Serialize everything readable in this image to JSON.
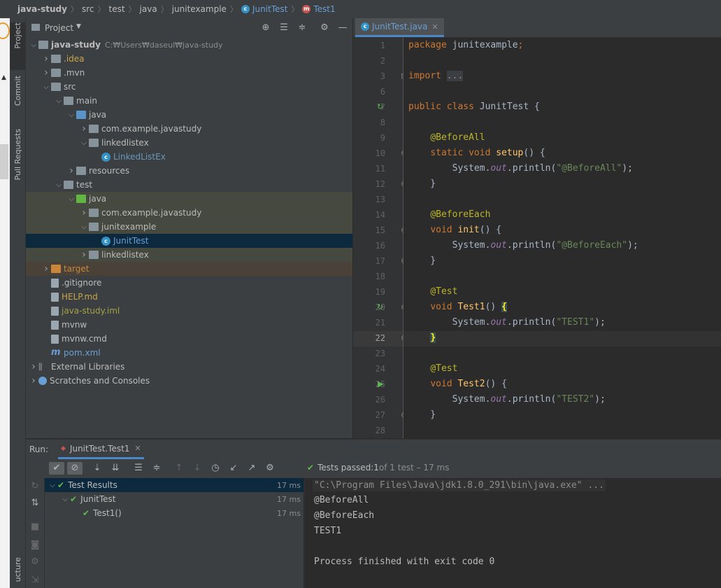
{
  "breadcrumb": [
    {
      "label": "java-study",
      "icon": "",
      "bold": true
    },
    {
      "label": "src",
      "icon": ""
    },
    {
      "label": "test",
      "icon": ""
    },
    {
      "label": "java",
      "icon": ""
    },
    {
      "label": "junitexample",
      "icon": ""
    },
    {
      "label": "JunitTest",
      "icon": "class-icon"
    },
    {
      "label": "Test1",
      "icon": "method-icon"
    }
  ],
  "left_strip": {
    "project": "Project",
    "commit": "Commit",
    "pull_requests": "Pull Requests",
    "structure": "ucture"
  },
  "project_panel": {
    "title": "Project",
    "tree": [
      {
        "label": "java-study",
        "suffix": "C:₩Users₩daseul₩java-study",
        "depth": 0,
        "arrow": "open",
        "icon": "folder",
        "color": "#bbbbbb",
        "bold": true
      },
      {
        "label": ".idea",
        "depth": 1,
        "arrow": "closed",
        "icon": "folder",
        "color": "#c9a64a"
      },
      {
        "label": ".mvn",
        "depth": 1,
        "arrow": "closed",
        "icon": "folder",
        "color": "#bbbbbb"
      },
      {
        "label": "src",
        "depth": 1,
        "arrow": "open",
        "icon": "folder",
        "color": "#bbbbbb"
      },
      {
        "label": "main",
        "depth": 2,
        "arrow": "open",
        "icon": "folder",
        "color": "#bbbbbb"
      },
      {
        "label": "java",
        "depth": 3,
        "arrow": "open",
        "icon": "folder-blue",
        "color": "#bbbbbb"
      },
      {
        "label": "com.example.javastudy",
        "depth": 4,
        "arrow": "closed",
        "icon": "folder",
        "color": "#bbbbbb"
      },
      {
        "label": "linkedlistex",
        "depth": 4,
        "arrow": "open",
        "icon": "folder",
        "color": "#bbbbbb"
      },
      {
        "label": "LinkedListEx",
        "depth": 5,
        "arrow": "",
        "icon": "cls",
        "color": "#6897bb"
      },
      {
        "label": "resources",
        "depth": 3,
        "arrow": "closed",
        "icon": "folder",
        "color": "#bbbbbb"
      },
      {
        "label": "test",
        "depth": 2,
        "arrow": "open",
        "icon": "folder",
        "color": "#bbbbbb"
      },
      {
        "label": "java",
        "depth": 3,
        "arrow": "open",
        "icon": "folder-green",
        "color": "#bbbbbb",
        "bg": "#45493f"
      },
      {
        "label": "com.example.javastudy",
        "depth": 4,
        "arrow": "closed",
        "icon": "folder",
        "color": "#bbbbbb",
        "bg": "#45493f"
      },
      {
        "label": "junitexample",
        "depth": 4,
        "arrow": "open",
        "icon": "folder",
        "color": "#bbbbbb",
        "bg": "#45493f"
      },
      {
        "label": "JunitTest",
        "depth": 5,
        "arrow": "",
        "icon": "cls",
        "color": "#6a9fd6",
        "bg": "#0d293e"
      },
      {
        "label": "linkedlistex",
        "depth": 4,
        "arrow": "closed",
        "icon": "folder",
        "color": "#bbbbbb",
        "bg": "#45493f"
      },
      {
        "label": "target",
        "depth": 1,
        "arrow": "closed",
        "icon": "folder-orange",
        "color": "#c9853a",
        "bg": "#4a4238"
      },
      {
        "label": ".gitignore",
        "depth": 1,
        "arrow": "",
        "icon": "file",
        "color": "#bbbbbb"
      },
      {
        "label": "HELP.md",
        "depth": 1,
        "arrow": "",
        "icon": "file",
        "color": "#c9a64a"
      },
      {
        "label": "java-study.iml",
        "depth": 1,
        "arrow": "",
        "icon": "file",
        "color": "#a5a349"
      },
      {
        "label": "mvnw",
        "depth": 1,
        "arrow": "",
        "icon": "file",
        "color": "#bbbbbb"
      },
      {
        "label": "mvnw.cmd",
        "depth": 1,
        "arrow": "",
        "icon": "file",
        "color": "#bbbbbb"
      },
      {
        "label": "pom.xml",
        "depth": 1,
        "arrow": "",
        "icon": "maven",
        "color": "#6a9fd6"
      },
      {
        "label": "External Libraries",
        "depth": 0,
        "arrow": "closed",
        "icon": "lib",
        "color": "#bbbbbb"
      },
      {
        "label": "Scratches and Consoles",
        "depth": 0,
        "arrow": "closed",
        "icon": "scratch",
        "color": "#bbbbbb"
      }
    ]
  },
  "editor": {
    "tab_label": "JunitTest.java",
    "lines": [
      {
        "n": "1",
        "seg": [
          [
            "kw",
            "package "
          ],
          [
            "",
            "junitexample"
          ],
          [
            "kw",
            ";"
          ]
        ]
      },
      {
        "n": "2",
        "seg": []
      },
      {
        "n": "3",
        "seg": [
          [
            "kw",
            "import "
          ],
          [
            "dim",
            "..."
          ]
        ]
      },
      {
        "n": "6",
        "seg": []
      },
      {
        "n": "7",
        "seg": [
          [
            "kw",
            "public class "
          ],
          [
            "",
            "JunitTest {"
          ]
        ]
      },
      {
        "n": "8",
        "seg": []
      },
      {
        "n": "9",
        "seg": [
          [
            "",
            "    "
          ],
          [
            "ann",
            "@BeforeAll"
          ]
        ]
      },
      {
        "n": "10",
        "seg": [
          [
            "",
            "    "
          ],
          [
            "kw",
            "static void "
          ],
          [
            "fn",
            "setup"
          ],
          [
            "",
            "() {"
          ]
        ]
      },
      {
        "n": "11",
        "seg": [
          [
            "",
            "        System."
          ],
          [
            "fld",
            "out"
          ],
          [
            "",
            ".println("
          ],
          [
            "str",
            "\"@BeforeAll\""
          ],
          [
            "",
            ");"
          ]
        ]
      },
      {
        "n": "12",
        "seg": [
          [
            "",
            "    }"
          ]
        ]
      },
      {
        "n": "13",
        "seg": []
      },
      {
        "n": "14",
        "seg": [
          [
            "",
            "    "
          ],
          [
            "ann",
            "@BeforeEach"
          ]
        ]
      },
      {
        "n": "15",
        "seg": [
          [
            "",
            "    "
          ],
          [
            "kw",
            "void "
          ],
          [
            "fn",
            "init"
          ],
          [
            "",
            "() {"
          ]
        ]
      },
      {
        "n": "16",
        "seg": [
          [
            "",
            "        System."
          ],
          [
            "fld",
            "out"
          ],
          [
            "",
            ".println("
          ],
          [
            "str",
            "\"@BeforeEach\""
          ],
          [
            "",
            ");"
          ]
        ]
      },
      {
        "n": "17",
        "seg": [
          [
            "",
            "    }"
          ]
        ]
      },
      {
        "n": "18",
        "seg": []
      },
      {
        "n": "19",
        "seg": [
          [
            "",
            "    "
          ],
          [
            "ann",
            "@Test"
          ]
        ]
      },
      {
        "n": "20",
        "seg": [
          [
            "",
            "    "
          ],
          [
            "kw",
            "void "
          ],
          [
            "fn",
            "Test1"
          ],
          [
            "",
            "() "
          ],
          [
            "brace",
            "{"
          ]
        ]
      },
      {
        "n": "21",
        "seg": [
          [
            "",
            "        System."
          ],
          [
            "fld",
            "out"
          ],
          [
            "",
            ".println("
          ],
          [
            "str",
            "\"TEST1\""
          ],
          [
            "",
            ");"
          ]
        ]
      },
      {
        "n": "22",
        "seg": [
          [
            "",
            "    "
          ],
          [
            "brace",
            "}"
          ]
        ],
        "current": true
      },
      {
        "n": "23",
        "seg": []
      },
      {
        "n": "24",
        "seg": [
          [
            "",
            "    "
          ],
          [
            "ann",
            "@Test"
          ]
        ]
      },
      {
        "n": "25",
        "seg": [
          [
            "",
            "    "
          ],
          [
            "kw",
            "void "
          ],
          [
            "fn",
            "Test2"
          ],
          [
            "",
            "() {"
          ]
        ]
      },
      {
        "n": "26",
        "seg": [
          [
            "",
            "        System."
          ],
          [
            "fld",
            "out"
          ],
          [
            "",
            ".println("
          ],
          [
            "str",
            "\"TEST2\""
          ],
          [
            "",
            ");"
          ]
        ]
      },
      {
        "n": "27",
        "seg": [
          [
            "",
            "    }"
          ]
        ]
      },
      {
        "n": "28",
        "seg": []
      }
    ]
  },
  "run_panel": {
    "label": "Run:",
    "config_tab": "JunitTest.Test1",
    "status_prefix": "Tests passed: ",
    "status_count": "1",
    "status_suffix": " of 1 test – 17 ms",
    "tree": [
      {
        "label": "Test Results",
        "duration": "17 ms",
        "depth": 0,
        "selected": true
      },
      {
        "label": "JunitTest",
        "duration": "17 ms",
        "depth": 1
      },
      {
        "label": "Test1()",
        "duration": "17 ms",
        "depth": 2
      }
    ],
    "console": [
      {
        "text": "\"C:\\Program Files\\Java\\jdk1.8.0_291\\bin\\java.exe\" ...",
        "cmd": true
      },
      {
        "text": "@BeforeAll"
      },
      {
        "text": "@BeforeEach"
      },
      {
        "text": "TEST1"
      },
      {
        "text": ""
      },
      {
        "text": "Process finished with exit code 0"
      }
    ]
  },
  "colors": {
    "accent": "#4a88c7",
    "pass": "#5fb852",
    "selection": "#0d293e"
  }
}
